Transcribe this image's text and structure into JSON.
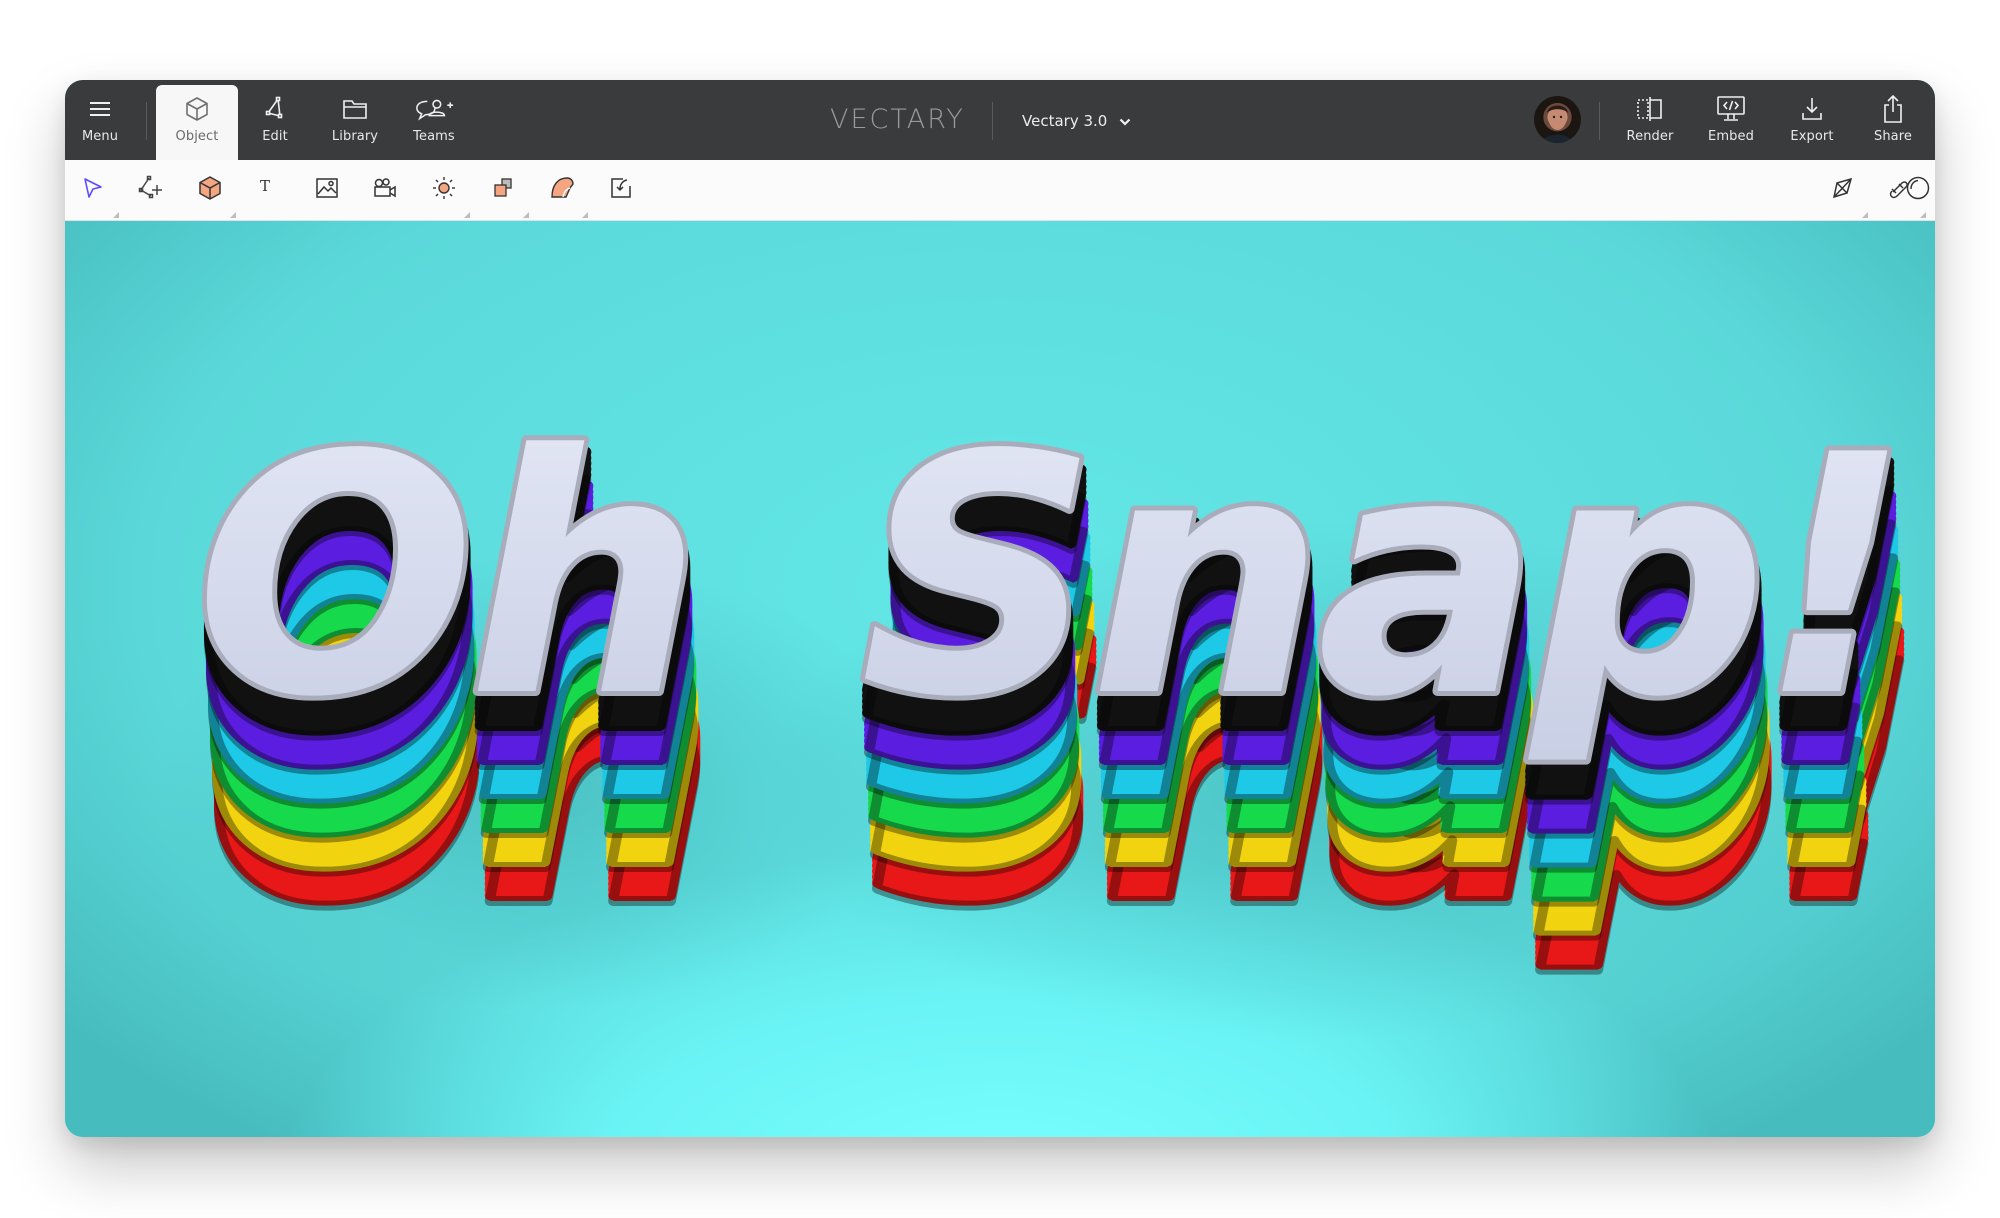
{
  "header": {
    "menu_label": "Menu",
    "tabs": [
      {
        "label": "Object",
        "icon": "cube-icon",
        "active": true
      },
      {
        "label": "Edit",
        "icon": "edit-vertex-icon",
        "active": false
      },
      {
        "label": "Library",
        "icon": "folder-icon",
        "active": false
      },
      {
        "label": "Teams",
        "icon": "teams-add-user-icon",
        "active": false
      }
    ],
    "logo": "VECTARY",
    "project_name": "Vectary 3.0",
    "right_actions": [
      {
        "label": "Render",
        "icon": "render-icon"
      },
      {
        "label": "Embed",
        "icon": "embed-icon"
      },
      {
        "label": "Export",
        "icon": "export-icon"
      },
      {
        "label": "Share",
        "icon": "share-icon"
      }
    ]
  },
  "toolbar": {
    "left_tools": [
      "select",
      "add-point",
      "primitives",
      "text",
      "image",
      "camera",
      "light",
      "duplicate",
      "materials",
      "import"
    ],
    "right_tools": [
      "align",
      "snap-magnet",
      "environment"
    ]
  },
  "scene": {
    "words": [
      "Oh",
      "Snap!"
    ],
    "top_color": "#d3d8ec",
    "layer_colors": [
      "#111111",
      "#5b1ee0",
      "#1dc9e6",
      "#17d94c",
      "#f1d40f",
      "#e81818"
    ],
    "background_color": "#5fe6e6"
  },
  "colors": {
    "header_bg": "#3a3b3d",
    "toolbar_bg": "#fbfbfb",
    "accent_select": "#5b4bff",
    "tool_fill": "#f4a582"
  }
}
